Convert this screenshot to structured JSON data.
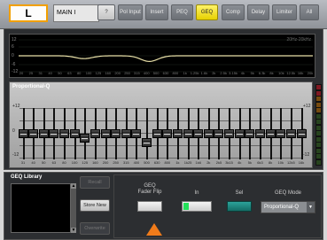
{
  "header": {
    "channel_id": "L",
    "channel_name": "MAIN I",
    "buttons": [
      {
        "label": "?",
        "state": "plain"
      },
      {
        "label": "Pol Input",
        "state": "normal"
      },
      {
        "label": "Insert",
        "state": "normal"
      },
      {
        "label": "PEQ",
        "state": "normal"
      },
      {
        "label": "GEQ",
        "state": "active"
      },
      {
        "label": "Comp",
        "state": "normal"
      },
      {
        "label": "Delay",
        "state": "normal"
      },
      {
        "label": "Limiter",
        "state": "normal"
      },
      {
        "label": "All",
        "state": "normal"
      }
    ]
  },
  "graph": {
    "y_labels": [
      "12",
      "6",
      "0",
      "-6",
      "-12"
    ],
    "range_text": "20Hz-20kHz",
    "freq_labels": [
      "20",
      "25",
      "31",
      "40",
      "50",
      "63",
      "80",
      "100",
      "125",
      "160",
      "200",
      "250",
      "315",
      "400",
      "500",
      "630",
      "800",
      "1k",
      "1.25k",
      "1.6k",
      "2k",
      "2.5k",
      "3.15k",
      "4k",
      "5k",
      "6.3k",
      "8k",
      "10k",
      "12.5k",
      "16k",
      "20k"
    ]
  },
  "faders": {
    "title": "Proportional-Q",
    "scale": [
      "+12",
      "0",
      "-12"
    ],
    "bands": [
      "31",
      "40",
      "50",
      "63",
      "80",
      "100",
      "125",
      "160",
      "200",
      "250",
      "315",
      "400",
      "500",
      "630",
      "800",
      "1k",
      "1k25",
      "1k6",
      "2k",
      "2k5",
      "3k15",
      "4k",
      "5k",
      "6k3",
      "8k",
      "10k",
      "12k5",
      "16k"
    ],
    "gain_db": [
      0,
      0,
      0,
      0,
      0,
      0,
      -2,
      0,
      0,
      0,
      0,
      0,
      -4,
      0,
      0,
      0,
      0,
      0,
      0,
      0,
      0,
      0,
      0,
      0,
      0,
      0,
      0,
      0
    ]
  },
  "library": {
    "title": "GEQ Library",
    "buttons": {
      "recall": "Recall",
      "store": "Store New",
      "overwrite": "Overwrite"
    },
    "scroll_up": "▲",
    "scroll_down": "▼"
  },
  "controls": {
    "flip_label": "GEQ\nFader Flip",
    "in_label": "In",
    "sel_label": "Sel",
    "mode_label": "GEQ Mode",
    "mode_value": "Proportional-Q",
    "mode_arrow": "▼"
  },
  "colors": {
    "accent_active": "#f2d800",
    "in_led": "#23e05a",
    "sel": "#1f8c84",
    "pointer": "#f07b1a",
    "curve": "#e9e0a8"
  }
}
